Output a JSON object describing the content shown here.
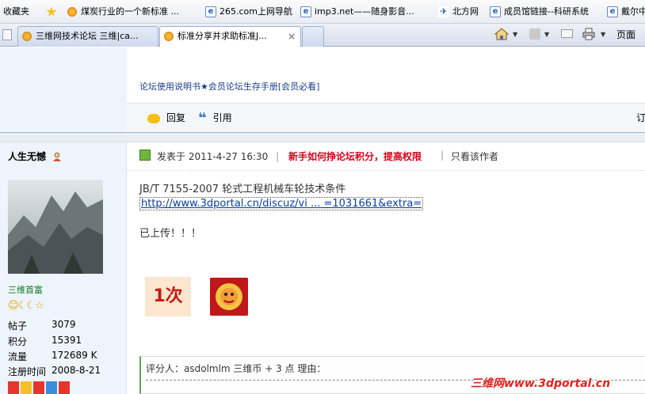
{
  "favorites_bar": {
    "label": "收藏夹",
    "items": [
      {
        "icon": "flower-icon",
        "label": "煤炭行业的一个新标准 ..."
      },
      {
        "icon": "ie-page-icon",
        "label": "265.com上网导航"
      },
      {
        "icon": "ie-page-icon",
        "label": "imp3.net——随身影音..."
      },
      {
        "icon": "beifang-icon",
        "label": "北方网"
      },
      {
        "icon": "ie-page-icon",
        "label": "成员馆链接--科研系统"
      },
      {
        "icon": "ie-page-icon",
        "label": "戴尔中"
      }
    ]
  },
  "tabs": [
    {
      "label": "三维网技术论坛 三维|ca..."
    },
    {
      "label": "标准分享并求助标准J..."
    }
  ],
  "toolbar": {
    "page_label": "页面"
  },
  "forum": {
    "manual_link": "论坛使用说明书★会员论坛生存手册[会员必看]",
    "reply_label": "回复",
    "quote_label": "引用",
    "right_cut": "订"
  },
  "author": {
    "name": "人生无憾",
    "rank": "三维首富",
    "stats": [
      {
        "label": "帖子",
        "value": "3079"
      },
      {
        "label": "积分",
        "value": "15391"
      },
      {
        "label": "流量",
        "value": "172689 K"
      },
      {
        "label": "注册时间",
        "value": "2008-8-21"
      }
    ]
  },
  "post": {
    "posted_at": "发表于  2011-4-27 16:30",
    "separator": "|",
    "newbie_link": "新手如何挣论坛积分，提高权限",
    "only_author": "只看该作者",
    "title": "JB/T 7155-2007 轮式工程机械车轮技术条件",
    "link": "http://www.3dportal.cn/discuz/vi ... =1031661&extra=",
    "body": "已上传！！！",
    "badge_text": "1次"
  },
  "rating": {
    "text": "评分人：asdolmlm 三维币 + 3 点  理由："
  },
  "watermark": "三维网www.3dportal.cn"
}
